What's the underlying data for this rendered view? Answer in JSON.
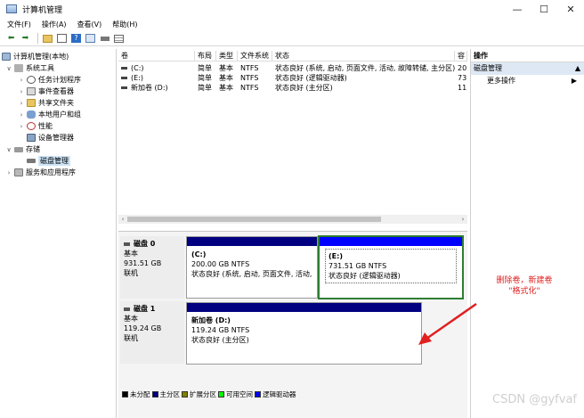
{
  "window": {
    "title": "计算机管理",
    "controls": [
      "—",
      "☐",
      "✕"
    ]
  },
  "menu": [
    "文件(F)",
    "操作(A)",
    "查看(V)",
    "帮助(H)"
  ],
  "toolbar": {
    "icons": [
      "back-icon",
      "forward-icon",
      "folder-up-icon",
      "properties-icon",
      "help-icon",
      "console-icon",
      "disk-icon",
      "list-icon"
    ]
  },
  "tree": {
    "root": "计算机管理(本地)",
    "system_tools": "系统工具",
    "task_scheduler": "任务计划程序",
    "event_viewer": "事件查看器",
    "shared_folders": "共享文件夹",
    "local_users": "本地用户和组",
    "performance": "性能",
    "device_manager": "设备管理器",
    "storage": "存储",
    "disk_management": "磁盘管理",
    "services_apps": "服务和应用程序"
  },
  "volumes": {
    "headers": [
      "卷",
      "布局",
      "类型",
      "文件系统",
      "状态",
      "容"
    ],
    "rows": [
      {
        "vol": "(C:)",
        "layout": "简单",
        "type": "基本",
        "fs": "NTFS",
        "status": "状态良好 (系统, 启动, 页面文件, 活动, 故障转储, 主分区)",
        "cap": "20"
      },
      {
        "vol": "(E:)",
        "layout": "简单",
        "type": "基本",
        "fs": "NTFS",
        "status": "状态良好 (逻辑驱动器)",
        "cap": "73"
      },
      {
        "vol": "新加卷 (D:)",
        "layout": "简单",
        "type": "基本",
        "fs": "NTFS",
        "status": "状态良好 (主分区)",
        "cap": "11"
      }
    ]
  },
  "disks": [
    {
      "name": "磁盘 0",
      "type": "基本",
      "size": "931.51 GB",
      "state": "联机",
      "partitions": [
        {
          "name": "(C:)",
          "size": "200.00 GB NTFS",
          "status": "状态良好 (系统, 启动, 页面文件, 活动, 故障转储,",
          "bar_color": "#000080"
        },
        {
          "name": "(E:)",
          "size": "731.51 GB NTFS",
          "status": "状态良好 (逻辑驱动器)",
          "bar_color": "#0000ff"
        }
      ]
    },
    {
      "name": "磁盘 1",
      "type": "基本",
      "size": "119.24 GB",
      "state": "联机",
      "partitions": [
        {
          "name": "新加卷 (D:)",
          "size": "119.24 GB NTFS",
          "status": "状态良好 (主分区)",
          "bar_color": "#000080"
        }
      ]
    }
  ],
  "legend": [
    {
      "label": "未分配",
      "color": "#000000"
    },
    {
      "label": "主分区",
      "color": "#000080"
    },
    {
      "label": "扩展分区",
      "color": "#808000"
    },
    {
      "label": "可用空间",
      "color": "#00ff00"
    },
    {
      "label": "逻辑驱动器",
      "color": "#0000ff"
    }
  ],
  "actions": {
    "header": "操作",
    "group": "磁盘管理",
    "more": "更多操作"
  },
  "annotation": {
    "line1": "删除卷，新建卷",
    "line2": "\"格式化\""
  },
  "watermark": "CSDN @gyfvaf"
}
